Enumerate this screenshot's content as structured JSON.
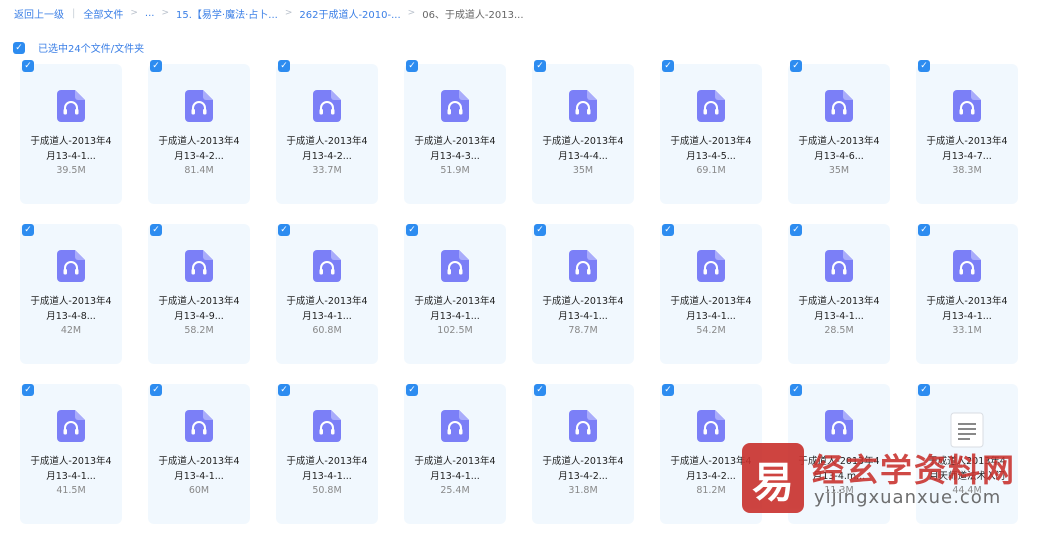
{
  "breadcrumb": {
    "back": "返回上一级",
    "items": [
      "全部文件",
      "...",
      "15.【易学·魔法·占卜...",
      "262于成道人-2010-...",
      "06、于成道人-2013..."
    ]
  },
  "selection": {
    "text": "已选中24个文件/文件夹"
  },
  "colors": {
    "accent": "#2d8cf0",
    "card_bg": "#f1f8fe",
    "audio_icon": "#7b7ff7",
    "watermark": "#c9302c"
  },
  "files": [
    {
      "line1": "于成道人-2013年4",
      "line2": "月13-4-1...",
      "size": "39.5M",
      "icon": "audio-file-icon"
    },
    {
      "line1": "于成道人-2013年4",
      "line2": "月13-4-2...",
      "size": "81.4M",
      "icon": "audio-file-icon"
    },
    {
      "line1": "于成道人-2013年4",
      "line2": "月13-4-2...",
      "size": "33.7M",
      "icon": "audio-file-icon"
    },
    {
      "line1": "于成道人-2013年4",
      "line2": "月13-4-3...",
      "size": "51.9M",
      "icon": "audio-file-icon"
    },
    {
      "line1": "于成道人-2013年4",
      "line2": "月13-4-4...",
      "size": "35M",
      "icon": "audio-file-icon"
    },
    {
      "line1": "于成道人-2013年4",
      "line2": "月13-4-5...",
      "size": "69.1M",
      "icon": "audio-file-icon"
    },
    {
      "line1": "于成道人-2013年4",
      "line2": "月13-4-6...",
      "size": "35M",
      "icon": "audio-file-icon"
    },
    {
      "line1": "于成道人-2013年4",
      "line2": "月13-4-7...",
      "size": "38.3M",
      "icon": "audio-file-icon"
    },
    {
      "line1": "于成道人-2013年4",
      "line2": "月13-4-8...",
      "size": "42M",
      "icon": "audio-file-icon"
    },
    {
      "line1": "于成道人-2013年4",
      "line2": "月13-4-9...",
      "size": "58.2M",
      "icon": "audio-file-icon"
    },
    {
      "line1": "于成道人-2013年4",
      "line2": "月13-4-1...",
      "size": "60.8M",
      "icon": "audio-file-icon"
    },
    {
      "line1": "于成道人-2013年4",
      "line2": "月13-4-1...",
      "size": "102.5M",
      "icon": "audio-file-icon"
    },
    {
      "line1": "于成道人-2013年4",
      "line2": "月13-4-1...",
      "size": "78.7M",
      "icon": "audio-file-icon"
    },
    {
      "line1": "于成道人-2013年4",
      "line2": "月13-4-1...",
      "size": "54.2M",
      "icon": "audio-file-icon"
    },
    {
      "line1": "于成道人-2013年4",
      "line2": "月13-4-1...",
      "size": "28.5M",
      "icon": "audio-file-icon"
    },
    {
      "line1": "于成道人-2013年4",
      "line2": "月13-4-1...",
      "size": "33.1M",
      "icon": "audio-file-icon"
    },
    {
      "line1": "于成道人-2013年4",
      "line2": "月13-4-1...",
      "size": "41.5M",
      "icon": "audio-file-icon"
    },
    {
      "line1": "于成道人-2013年4",
      "line2": "月13-4-1...",
      "size": "60M",
      "icon": "audio-file-icon"
    },
    {
      "line1": "于成道人-2013年4",
      "line2": "月13-4-1...",
      "size": "50.8M",
      "icon": "audio-file-icon"
    },
    {
      "line1": "于成道人-2013年4",
      "line2": "月13-4-1...",
      "size": "25.4M",
      "icon": "audio-file-icon"
    },
    {
      "line1": "于成道人-2013年4",
      "line2": "月13-4-2...",
      "size": "31.8M",
      "icon": "audio-file-icon"
    },
    {
      "line1": "于成道人-2013年4",
      "line2": "月13-4-2...",
      "size": "81.2M",
      "icon": "audio-file-icon"
    },
    {
      "line1": "于成道人-2013年4",
      "line2": "月13-4.m...",
      "size": "11.3M",
      "icon": "audio-file-icon"
    },
    {
      "line1": "于成道人2013年4",
      "line2": "月天师道法术入门",
      "size": "44.4M",
      "icon": "document-file-icon"
    }
  ],
  "watermark": {
    "title": "经玄学资料网",
    "url": "yijingxuanxue.com"
  }
}
